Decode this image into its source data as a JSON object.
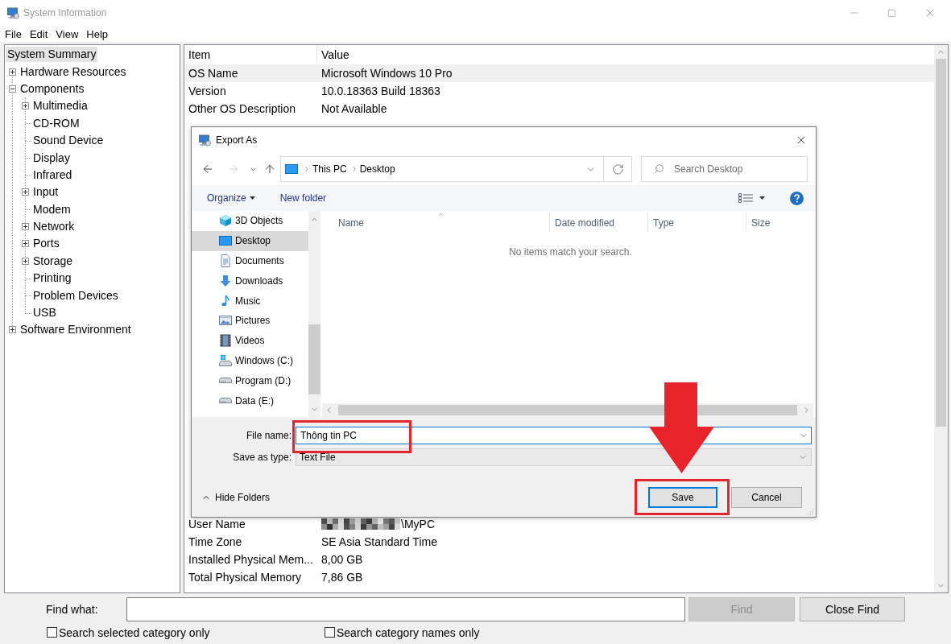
{
  "window": {
    "title": "System Information"
  },
  "menu": [
    "File",
    "Edit",
    "View",
    "Help"
  ],
  "tree": [
    {
      "label": "System Summary",
      "selected": true
    },
    {
      "label": "Hardware Resources",
      "selected": false,
      "expanded": false
    },
    {
      "label": "Components",
      "selected": false,
      "expanded": true,
      "children": [
        {
          "label": "Multimedia",
          "selected": false,
          "expanded": false
        },
        {
          "label": "CD-ROM",
          "selected": false
        },
        {
          "label": "Sound Device",
          "selected": false
        },
        {
          "label": "Display",
          "selected": false
        },
        {
          "label": "Infrared",
          "selected": false
        },
        {
          "label": "Input",
          "selected": false,
          "expanded": false
        },
        {
          "label": "Modem",
          "selected": false
        },
        {
          "label": "Network",
          "selected": false,
          "expanded": false
        },
        {
          "label": "Ports",
          "selected": false,
          "expanded": false
        },
        {
          "label": "Storage",
          "selected": false,
          "expanded": false
        },
        {
          "label": "Printing",
          "selected": false
        },
        {
          "label": "Problem Devices",
          "selected": false
        },
        {
          "label": "USB",
          "selected": false
        }
      ]
    },
    {
      "label": "Software Environment",
      "selected": false,
      "expanded": false
    }
  ],
  "table": {
    "columns": [
      "Item",
      "Value"
    ],
    "rows": [
      {
        "item": "OS Name",
        "value": "Microsoft Windows 10 Pro",
        "selected": true
      },
      {
        "item": "Version",
        "value": "10.0.18363 Build 18363",
        "selected": false
      },
      {
        "item": "Other OS Description",
        "value": "Not Available",
        "selected": false
      }
    ],
    "lower_rows": [
      {
        "item": "User Name",
        "value": "\\MyPC",
        "selected": false,
        "value_obscured": true
      },
      {
        "item": "Time Zone",
        "value": "SE Asia Standard Time",
        "selected": false
      },
      {
        "item": "Installed Physical Mem...",
        "value": "8,00 GB",
        "selected": false
      },
      {
        "item": "Total Physical Memory",
        "value": "7,86 GB",
        "selected": false
      }
    ]
  },
  "dialog": {
    "title": "Export As",
    "nav_buttons": [
      {
        "kind": "back",
        "disabled": false
      },
      {
        "kind": "forward",
        "disabled": true
      },
      {
        "kind": "recent",
        "disabled": false
      },
      {
        "kind": "up",
        "disabled": false
      }
    ],
    "path": [
      "This PC",
      "Desktop"
    ],
    "search": {
      "placeholder": "Search Desktop"
    },
    "toolbar": [
      {
        "label": "Organize",
        "menu": true
      },
      {
        "label": "New folder",
        "menu": false
      }
    ],
    "nav_items": [
      {
        "label": "3D Objects",
        "kind": "objects",
        "selected": false
      },
      {
        "label": "Desktop",
        "kind": "desktop",
        "selected": true
      },
      {
        "label": "Documents",
        "kind": "documents",
        "selected": false
      },
      {
        "label": "Downloads",
        "kind": "downloads",
        "selected": false
      },
      {
        "label": "Music",
        "kind": "music",
        "selected": false
      },
      {
        "label": "Pictures",
        "kind": "pictures",
        "selected": false
      },
      {
        "label": "Videos",
        "kind": "videos",
        "selected": false
      },
      {
        "label": "Windows (C:)",
        "kind": "system",
        "selected": false
      },
      {
        "label": "Program (D:)",
        "kind": "drive",
        "selected": false
      },
      {
        "label": "Data (E:)",
        "kind": "drive",
        "selected": false
      }
    ],
    "columns": [
      {
        "label": "Name",
        "sorted": true
      },
      {
        "label": "Date modified",
        "sorted": false
      },
      {
        "label": "Type",
        "sorted": false
      },
      {
        "label": "Size",
        "sorted": false
      }
    ],
    "empty_message": "No items match your search.",
    "file_name": {
      "label": "File name:",
      "value": "Thông tin PC",
      "highlighted": true
    },
    "save_as_type": {
      "label": "Save as type:",
      "value": "Text File"
    },
    "hide_folders": "Hide Folders",
    "buttons": [
      {
        "label": "Save",
        "kind": "primary",
        "highlighted": true,
        "arrow": true
      },
      {
        "label": "Cancel",
        "kind": "secondary",
        "highlighted": false,
        "arrow": false
      }
    ]
  },
  "find_bar": {
    "label": "Find what:",
    "buttons": [
      {
        "label": "Find",
        "disabled": true
      },
      {
        "label": "Close Find",
        "disabled": false
      }
    ],
    "checkboxes": [
      {
        "label": "Search selected category only",
        "checked": false
      },
      {
        "label": "Search category names only",
        "checked": false
      }
    ]
  }
}
